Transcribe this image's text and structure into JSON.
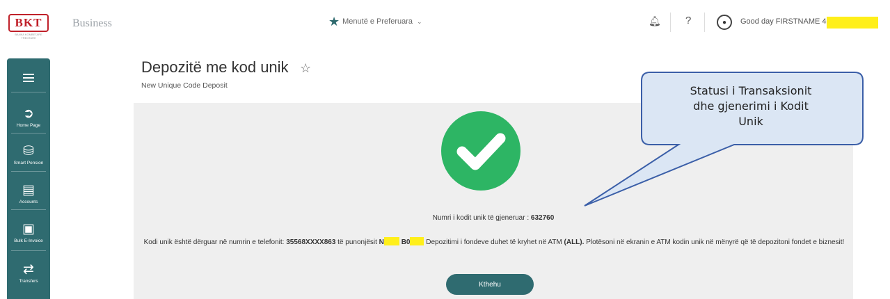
{
  "header": {
    "logo_text": "BKT",
    "logo_subtext": "BANKA KOMBETARE TREGTARE",
    "brand_text": "Business",
    "favorites_label": "Menutë e Preferuara",
    "greeting": "Good day FIRSTNAME 40"
  },
  "sidebar": {
    "items": [
      {
        "label": "Home Page",
        "icon": "home-icon"
      },
      {
        "label": "Smart Pension",
        "icon": "pension-icon"
      },
      {
        "label": "Accounts",
        "icon": "accounts-icon"
      },
      {
        "label": "Bulk E-Invoice",
        "icon": "invoice-icon"
      },
      {
        "label": "Transfers",
        "icon": "transfer-icon"
      }
    ]
  },
  "page": {
    "title": "Depozitë me kod unik",
    "subtitle": "New Unique Code Deposit",
    "code_label": "Numri i kodit unik të gjeneruar :",
    "code_value": "632760",
    "msg_part1": "Kodi unik është dërguar në numrin e telefonit:",
    "phone": "35568XXXX863",
    "msg_part2": "të punonjësit",
    "employee_start": "N",
    "employee_mid": "B0",
    "msg_part3": "Depozitimi i fondeve duhet të kryhet në ATM",
    "currency": "(ALL).",
    "msg_part4": "Plotësoni në ekranin e ATM kodin unik në mënyrë që të depozitoni fondet e biznesit!",
    "back_button": "Kthehu"
  },
  "callout": {
    "line1": "Statusi i Transaksionit",
    "line2": "dhe gjenerimi i Kodit",
    "line3": "Unik"
  },
  "colors": {
    "teal": "#2f6b70",
    "success_green": "#2db564",
    "redaction": "#ffef1a",
    "callout_fill": "#dbe6f4",
    "callout_stroke": "#3b5fa8"
  }
}
